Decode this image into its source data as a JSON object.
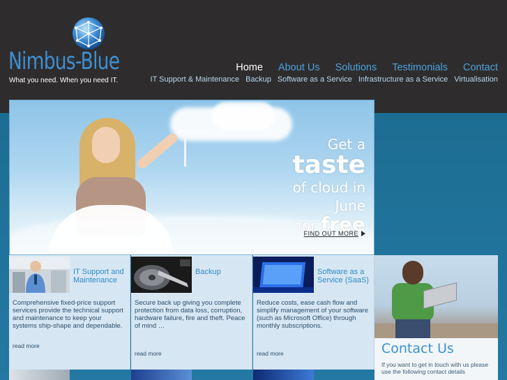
{
  "brand": {
    "name": "Nimbus-Blue",
    "tagline": "What you need. When you need IT."
  },
  "nav": {
    "main": [
      "Home",
      "About Us",
      "Solutions",
      "Testimonials",
      "Contact"
    ],
    "active": "Home",
    "sub": [
      "IT Support & Maintenance",
      "Backup",
      "Software as a Service",
      "Infrastructure as a Service",
      "Virtualisation"
    ]
  },
  "hero": {
    "line1": "Get a",
    "line2": "taste",
    "line3": "of cloud in",
    "line4": "June",
    "line5_prefix": "for",
    "line5_emph": "free",
    "cta": "FIND OUT MORE"
  },
  "services": [
    {
      "title": "IT Support and Maintenance",
      "description": "Comprehensive fixed-price support services provide the technical support and maintenance to keep your systems ship-shape and dependable.",
      "more": "read more"
    },
    {
      "title": "Backup",
      "description": "Secure back up giving you complete protection from data loss, corruption, hardware failure, fire and theft. Peace of mind …",
      "more": "read more"
    },
    {
      "title": "Software as a Service (SaaS)",
      "description": "Reduce costs, ease cash flow and simplify management of your software (such as Microsoft Office) through monthly subscriptions.",
      "more": "read more"
    }
  ],
  "contact": {
    "title": "Contact Us",
    "description": "If you want to get in touch with us please use the following contact details"
  },
  "colors": {
    "header_bg": "#2e2c2d",
    "accent_blue": "#3e8ed0",
    "content_bg": "#1d6d93",
    "card_bg": "#d6e7f3"
  }
}
